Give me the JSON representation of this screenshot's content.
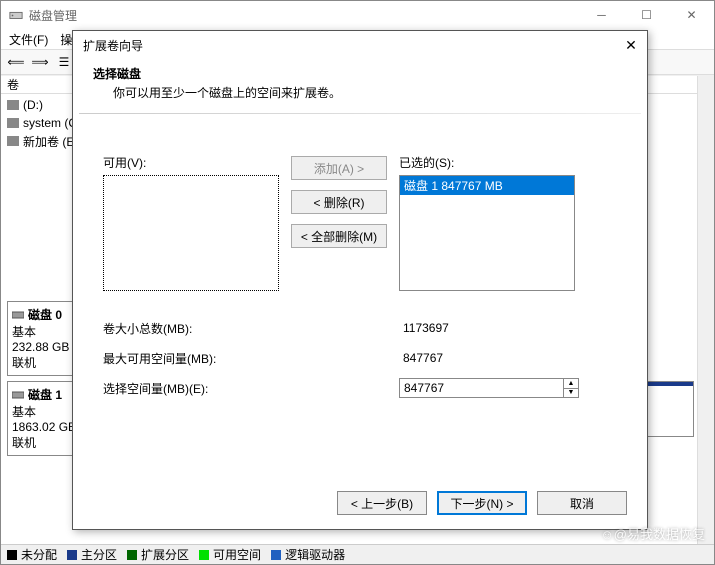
{
  "main": {
    "title": "磁盘管理",
    "menu_file": "文件(F)",
    "menu_action": "操",
    "vol_header": "卷",
    "volumes": [
      {
        "label": "(D:)"
      },
      {
        "label": "system (C"
      },
      {
        "label": "新加卷 (E"
      }
    ],
    "disk0": {
      "name": "磁盘 0",
      "type": "基本",
      "size": "232.88 GB",
      "status": "联机"
    },
    "disk1": {
      "name": "磁盘 1",
      "type": "基本",
      "size": "1863.02 GB",
      "status": "联机"
    }
  },
  "legend": {
    "unalloc": "未分配",
    "primary": "主分区",
    "extended": "扩展分区",
    "free": "可用空间",
    "logical": "逻辑驱动器",
    "colors": {
      "unalloc": "#000000",
      "primary": "#1a3a8a",
      "extended": "#006600",
      "free": "#00e000",
      "logical": "#2060c0"
    }
  },
  "dialog": {
    "title": "扩展卷向导",
    "heading": "选择磁盘",
    "subheading": "你可以用至少一个磁盘上的空间来扩展卷。",
    "available_label": "可用(V):",
    "selected_label": "已选的(S):",
    "add_btn": "添加(A) >",
    "remove_btn": "< 删除(R)",
    "remove_all_btn": "< 全部删除(M)",
    "selected_items": [
      "磁盘 1    847767 MB"
    ],
    "total_label": "卷大小总数(MB):",
    "total_value": "1173697",
    "max_label": "最大可用空间量(MB):",
    "max_value": "847767",
    "space_label": "选择空间量(MB)(E):",
    "space_value": "847767",
    "back": "< 上一步(B)",
    "next": "下一步(N) >",
    "cancel": "取消"
  },
  "watermark": "☺@易我数据恢复"
}
